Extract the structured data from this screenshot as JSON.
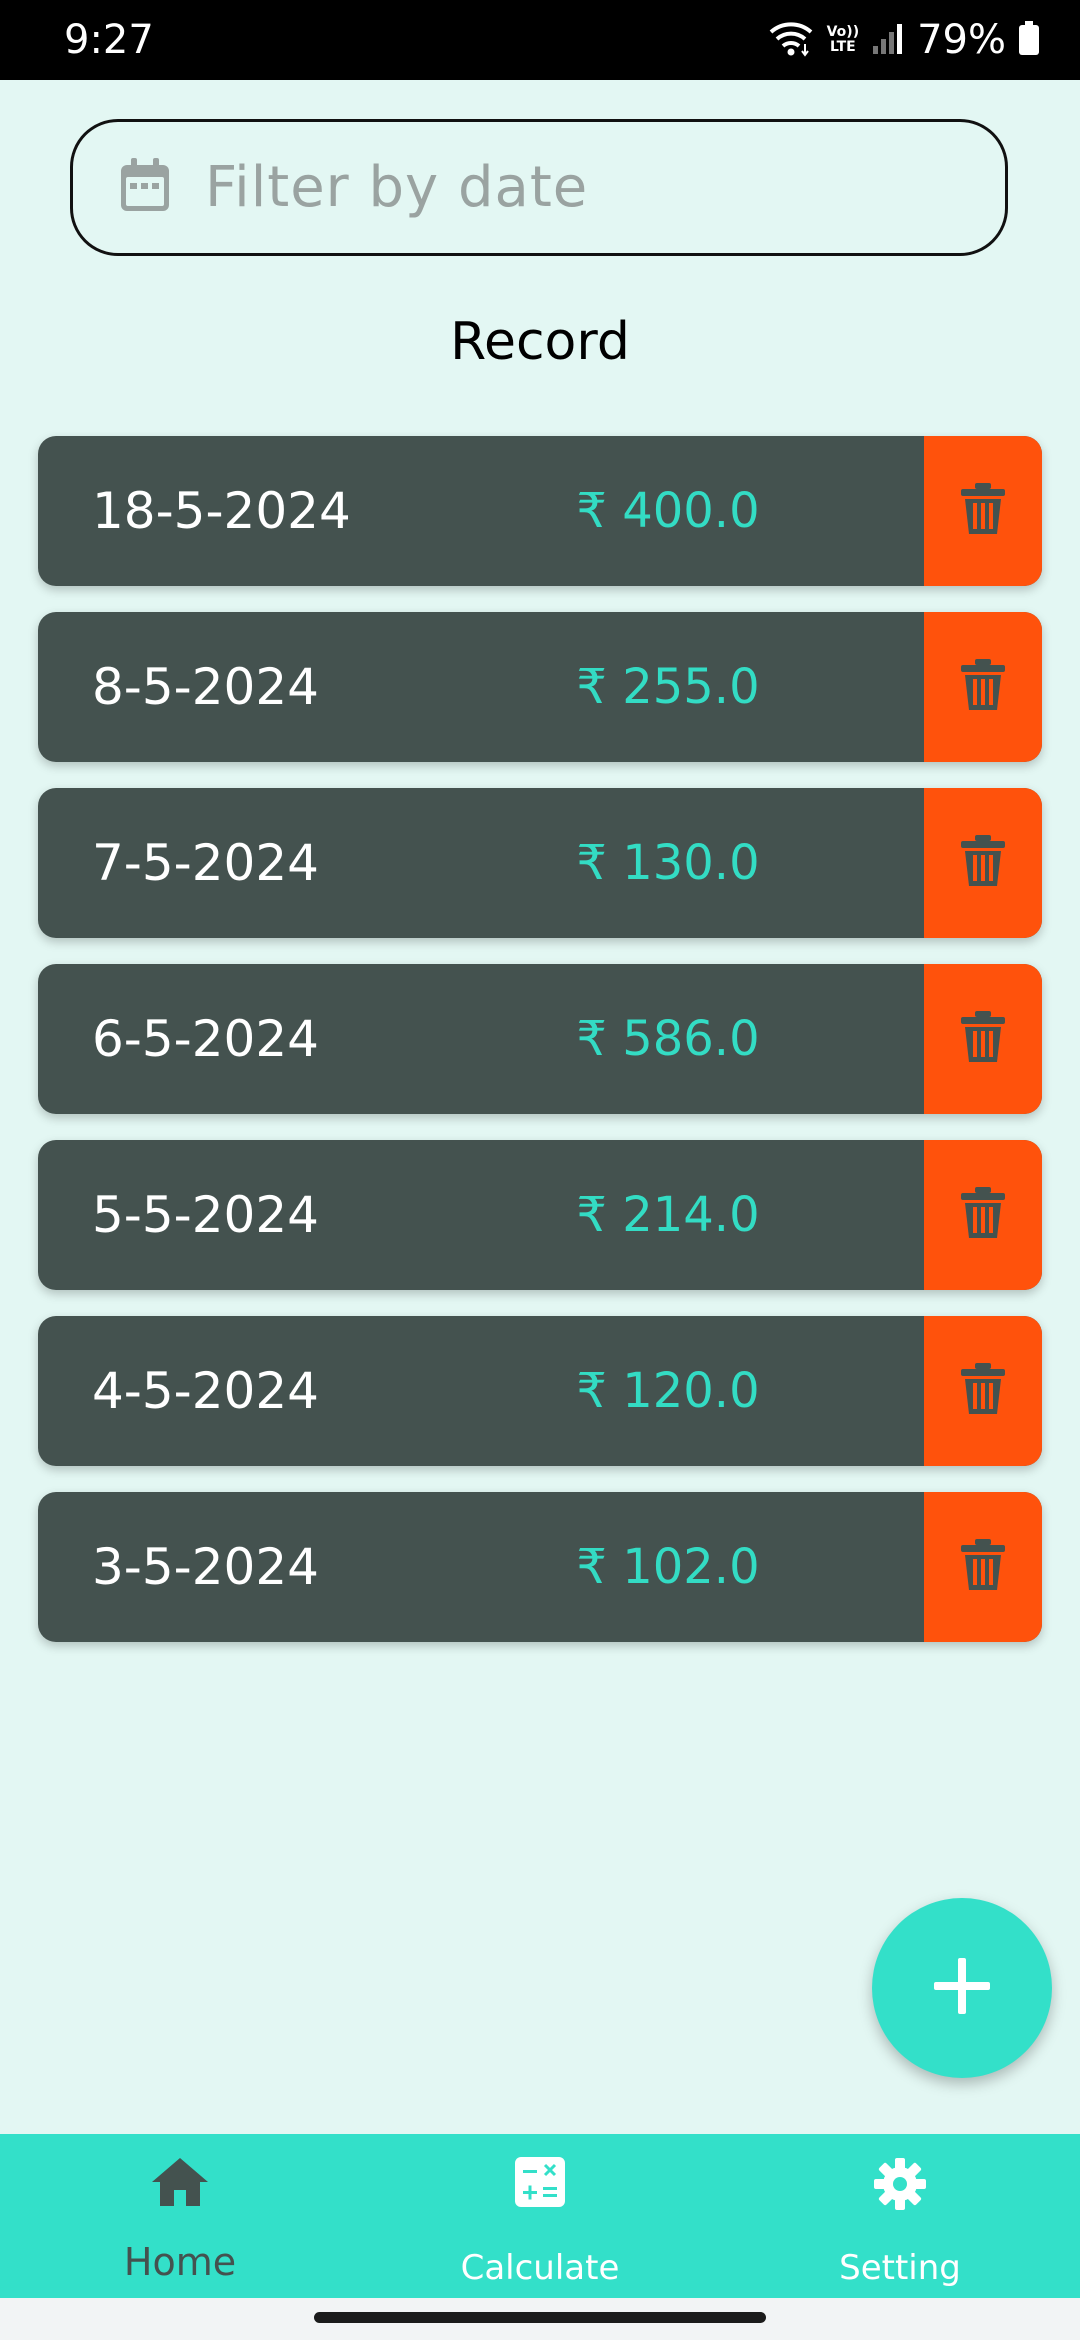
{
  "status_bar": {
    "time": "9:27",
    "network_label_top": "Vo))",
    "network_label_bottom": "LTE",
    "battery_percent": "79%"
  },
  "filter": {
    "placeholder": "Filter by date",
    "value": "",
    "icon": "calendar-icon"
  },
  "page_title": "Record",
  "records": [
    {
      "date": "18-5-2024",
      "amount": "₹ 400.0"
    },
    {
      "date": "8-5-2024",
      "amount": "₹ 255.0"
    },
    {
      "date": "7-5-2024",
      "amount": "₹ 130.0"
    },
    {
      "date": "6-5-2024",
      "amount": "₹ 586.0"
    },
    {
      "date": "5-5-2024",
      "amount": "₹ 214.0"
    },
    {
      "date": "4-5-2024",
      "amount": "₹ 120.0"
    },
    {
      "date": "3-5-2024",
      "amount": "₹ 102.0"
    }
  ],
  "fab": {
    "icon": "plus-icon"
  },
  "bottom_nav": {
    "items": [
      {
        "label": "Home",
        "icon": "home-icon",
        "active": true
      },
      {
        "label": "Calculate",
        "icon": "calculator-icon",
        "active": false
      },
      {
        "label": "Setting",
        "icon": "gear-icon",
        "active": false
      }
    ]
  },
  "colors": {
    "background": "#e3f7f3",
    "card": "#44524f",
    "amount_text": "#33dcc4",
    "delete": "#ff520c",
    "accent": "#33e0c9"
  }
}
